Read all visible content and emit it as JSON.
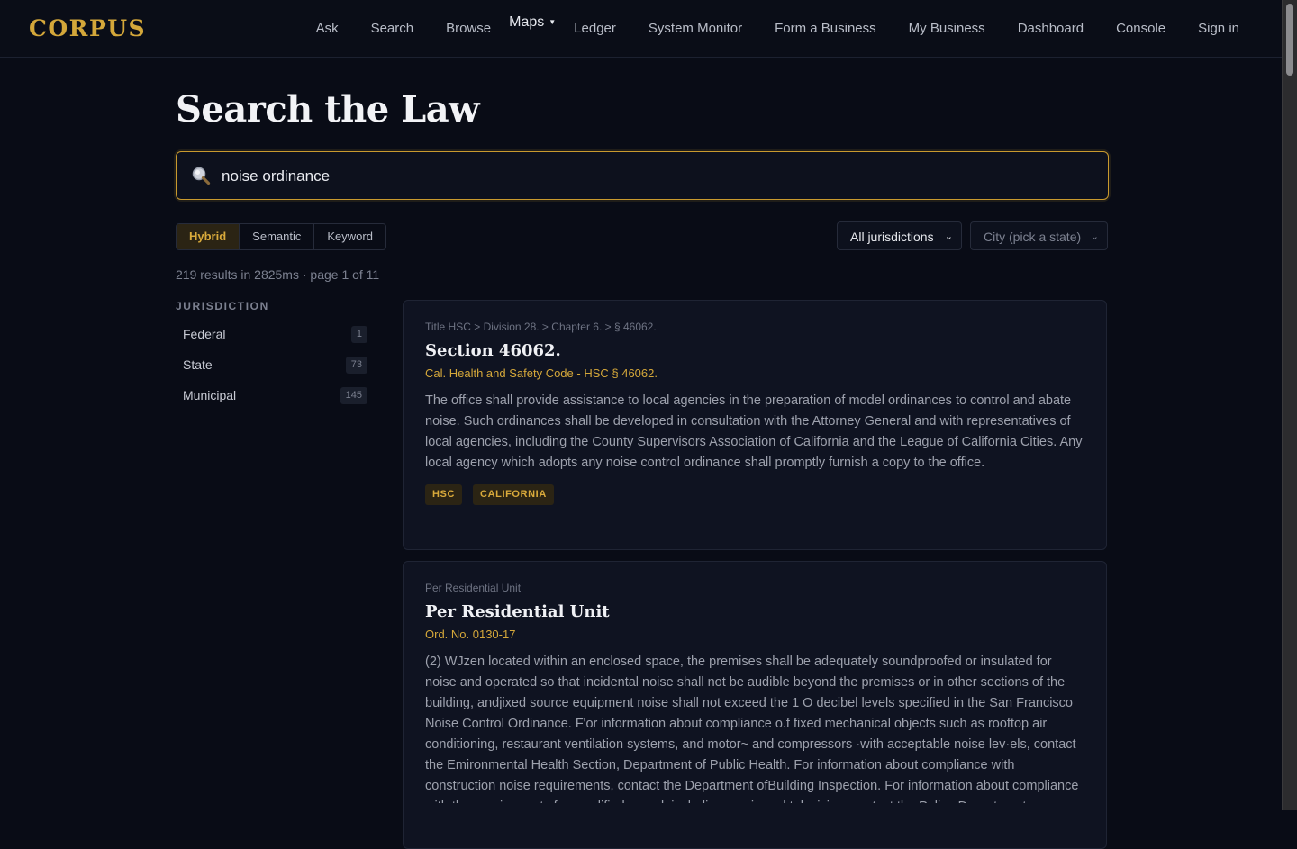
{
  "nav": {
    "logo": "CORPUS",
    "items": [
      "Ask",
      "Search",
      "Browse",
      "Maps",
      "Ledger",
      "System Monitor",
      "Form a Business",
      "My Business",
      "Dashboard",
      "Console",
      "Sign in"
    ]
  },
  "page": {
    "title": "Search the Law"
  },
  "search": {
    "value": "noise ordinance",
    "icon": "magnifier-icon"
  },
  "modes": {
    "items": [
      "Hybrid",
      "Semantic",
      "Keyword"
    ],
    "active": "Hybrid"
  },
  "filters": {
    "jurisdiction": "All jurisdictions",
    "city": "City (pick a state)"
  },
  "results_meta": "219 results in 2825ms · page 1 of 11",
  "facets": {
    "title": "JURISDICTION",
    "items": [
      {
        "label": "Federal",
        "count": "1"
      },
      {
        "label": "State",
        "count": "73"
      },
      {
        "label": "Municipal",
        "count": "145"
      }
    ]
  },
  "results": [
    {
      "crumb": "Title HSC > Division 28. > Chapter 6. > § 46062.",
      "title": "Section 46062.",
      "citation": "Cal. Health and Safety Code - HSC § 46062.",
      "snippet": "The office shall provide assistance to local agencies in the preparation of model ordinances to control and abate noise. Such ordinances shall be developed in consultation with the Attorney General and with representatives of local agencies, including the County Supervisors Association of California and the League of California Cities. Any local agency which adopts any noise control ordinance shall promptly furnish a copy to the office.",
      "tags": [
        "HSC",
        "CALIFORNIA"
      ]
    },
    {
      "crumb": "Per Residential Unit",
      "title": "Per Residential Unit",
      "citation": "Ord. No. 0130-17",
      "snippet": "(2) WJzen located within an enclosed space, the premises shall be adequately soundproofed or insulated for noise and operated so that incidental noise shall not be audible beyond the premises or in other sections of the building, andjixed source equipment noise shall not exceed the 1 O decibel levels specified in the San Francisco Noise Control Ordinance. F'or information about compliance o.f fixed mechanical objects such as rooftop air conditioning, restaurant ventilation systems, and motor~ and compressors ·with acceptable noise lev·els, contact the Emironmental Health Section, Department of Public Health. For information about compliance with construction noise requirements, contact the Department ofBuilding Inspection. For information about compliance with the requirements for amplified sound, including music and television, contact the Police Department.",
      "tags": []
    }
  ],
  "colors": {
    "accent": "#d4a73a",
    "background": "#090c16",
    "card": "#0f1321"
  }
}
